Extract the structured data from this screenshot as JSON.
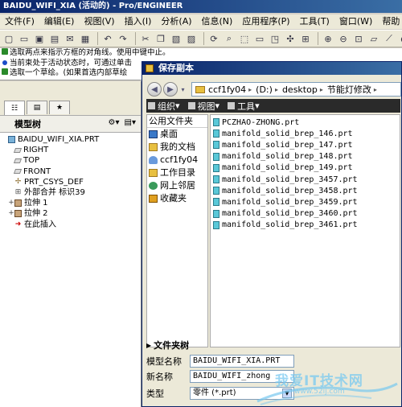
{
  "title_bar": {
    "text": "BAIDU_WIFI_XIA (活动的) - Pro/ENGINEER"
  },
  "menubar": {
    "items": [
      "文件(F)",
      "编辑(E)",
      "视图(V)",
      "插入(I)",
      "分析(A)",
      "信息(N)",
      "应用程序(P)",
      "工具(T)",
      "窗口(W)",
      "帮助"
    ]
  },
  "messages": [
    "选取两点来指示方框的对角线。使用中键中止。",
    "当前束处于活动状态时，可通过单击",
    "选取一个草绘。(如果首选内部草绘"
  ],
  "left_panel": {
    "tree_title": "模型树",
    "tree": [
      {
        "label": "BAIDU_WIFI_XIA.PRT",
        "icon": "part-icon",
        "expand": "",
        "indent": 0
      },
      {
        "label": "RIGHT",
        "icon": "datum-plane-icon",
        "expand": "",
        "indent": 1
      },
      {
        "label": "TOP",
        "icon": "datum-plane-icon",
        "expand": "",
        "indent": 1
      },
      {
        "label": "FRONT",
        "icon": "datum-plane-icon",
        "expand": "",
        "indent": 1
      },
      {
        "label": "PRT_CSYS_DEF",
        "icon": "csys-icon",
        "expand": "",
        "indent": 1
      },
      {
        "label": "外部合并 标识39",
        "icon": "merge-icon",
        "expand": "",
        "indent": 1
      },
      {
        "label": "拉伸 1",
        "icon": "extrude-icon",
        "expand": "+",
        "indent": 1
      },
      {
        "label": "拉伸 2",
        "icon": "extrude-icon",
        "expand": "+",
        "indent": 1
      },
      {
        "label": "在此插入",
        "icon": "insert-here-icon",
        "expand": "",
        "indent": 1
      }
    ]
  },
  "dialog": {
    "title": "保存副本",
    "address": [
      "ccf1fy04",
      "(D:)",
      "desktop",
      "节能灯修改"
    ],
    "toolbar": {
      "organize": "组织",
      "view": "视图",
      "tools": "工具"
    },
    "places_header": "公用文件夹",
    "places": [
      {
        "label": "桌面",
        "icon": "desktop-icon"
      },
      {
        "label": "我的文档",
        "icon": "documents-icon"
      },
      {
        "label": "ccf1fy04",
        "icon": "computer-icon"
      },
      {
        "label": "工作目录",
        "icon": "working-dir-icon"
      },
      {
        "label": "网上邻居",
        "icon": "network-icon"
      },
      {
        "label": "收藏夹",
        "icon": "favorites-icon"
      }
    ],
    "files": [
      "PCZHAO-ZHONG.prt",
      "manifold_solid_brep_146.prt",
      "manifold_solid_brep_147.prt",
      "manifold_solid_brep_148.prt",
      "manifold_solid_brep_149.prt",
      "manifold_solid_brep_3457.prt",
      "manifold_solid_brep_3458.prt",
      "manifold_solid_brep_3459.prt",
      "manifold_solid_brep_3460.prt",
      "manifold_solid_brep_3461.prt"
    ],
    "folder_tree_label": "文件夹树",
    "model_name_label": "模型名称",
    "model_name_value": "BAIDU_WIFI_XIA.PRT",
    "new_name_label": "新名称",
    "new_name_value": "BAIDU_WIFI_zhong",
    "type_label": "类型",
    "type_value": "零件 (*.prt)"
  },
  "watermark": {
    "text": "我爱IT技术网",
    "sub": "www.52ij.com"
  },
  "colors": {
    "title_start": "#0a246a",
    "title_end": "#3a6ea5",
    "graphics_bg": "#1a1a2e"
  }
}
